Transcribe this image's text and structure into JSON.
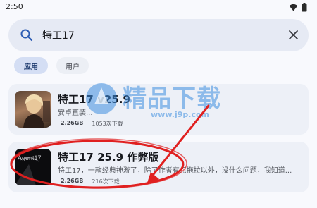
{
  "status_bar": {
    "time": "2:50"
  },
  "search": {
    "value": "特工17"
  },
  "filters": [
    {
      "label": "应用",
      "selected": true
    },
    {
      "label": "用户",
      "selected": false
    }
  ],
  "results": [
    {
      "title": "特工17 v25.9",
      "description": "安卓直装...",
      "size": "2.26GB",
      "downloads": "1053次下载"
    },
    {
      "title": "特工17 25.9 作弊版",
      "description": "特工17，一款经典神游了，除了作者有点拖拉以外，没什么问题，我知道...",
      "size": "2.26GB",
      "downloads": "216次下载",
      "thumb_text": "Agent17"
    }
  ],
  "watermark": {
    "text": "精品下载",
    "url": "www.j9p.com"
  },
  "colors": {
    "background": "#f8f9fd",
    "search_bg": "#e6eaf4",
    "chip_selected": "#d4def4",
    "card_bg": "#edf0f7",
    "accent": "#2b5bb3",
    "annotation": "#e02020"
  }
}
